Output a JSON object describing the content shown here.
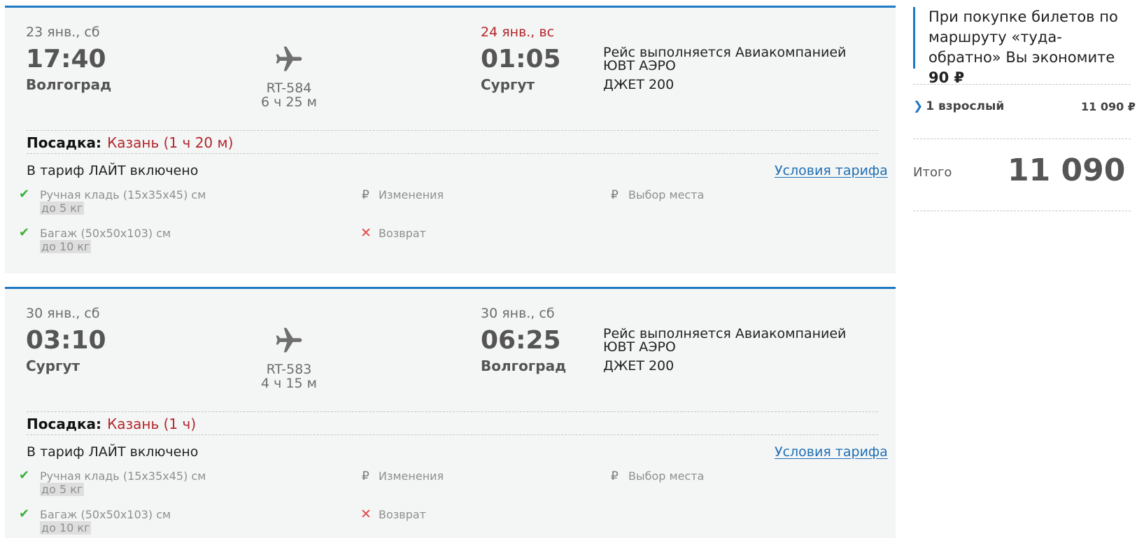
{
  "flights": [
    {
      "dep_date": "23 янв., сб",
      "dep_time": "17:40",
      "dep_city": "Волгоград",
      "flight_no": "RT-584",
      "duration": "6 ч 25 м",
      "arr_date": "24 янв., вс",
      "arr_time": "01:05",
      "arr_city": "Сургут",
      "operator": "Рейс выполняется Авиакомпанией ЮВТ АЭРО",
      "aircraft": "ДЖЕТ 200",
      "stop_label": "Посадка:",
      "stop_value": "Казань (1 ч 20 м)",
      "tariff_text": "В тариф ЛАЙТ включено",
      "conditions_link": "Условия тарифа",
      "features": {
        "hand_bag": "Ручная кладь (15x35x45) см",
        "hand_bag_weight": "до 5 кг",
        "baggage": "Багаж (50x50x103) см",
        "baggage_weight": "до 10 кг",
        "changes": "Изменения",
        "refund": "Возврат",
        "seat": "Выбор места"
      }
    },
    {
      "dep_date": "30 янв., сб",
      "dep_time": "03:10",
      "dep_city": "Сургут",
      "flight_no": "RT-583",
      "duration": "4 ч 15 м",
      "arr_date": "30 янв., сб",
      "arr_time": "06:25",
      "arr_city": "Волгоград",
      "operator": "Рейс выполняется Авиакомпанией ЮВТ АЭРО",
      "aircraft": "ДЖЕТ 200",
      "stop_label": "Посадка:",
      "stop_value": "Казань (1 ч)",
      "tariff_text": "В тариф ЛАЙТ включено",
      "conditions_link": "Условия тарифа",
      "features": {
        "hand_bag": "Ручная кладь (15x35x45) см",
        "hand_bag_weight": "до 5 кг",
        "baggage": "Багаж (50x50x103) см",
        "baggage_weight": "до 10 кг",
        "changes": "Изменения",
        "refund": "Возврат",
        "seat": "Выбор места"
      }
    }
  ],
  "icons": {
    "included": "check-icon",
    "paid": "ruble-icon",
    "not_available": "cross-icon",
    "plane": "airplane-icon",
    "expand": "chevron-right-icon"
  },
  "sidebar": {
    "promo_text": "При покупке билетов по маршруту «туда-обратно» Вы экономите",
    "promo_amount": "90 ₽",
    "passenger_label": "1 взрослый",
    "passenger_price": "11 090 ₽",
    "total_label": "Итого",
    "total_value": "11 090 ₽"
  },
  "colors": {
    "accent": "#1e78c2",
    "warning": "#b2272c",
    "included": "#3ab23a",
    "not_available": "#e0454b"
  }
}
